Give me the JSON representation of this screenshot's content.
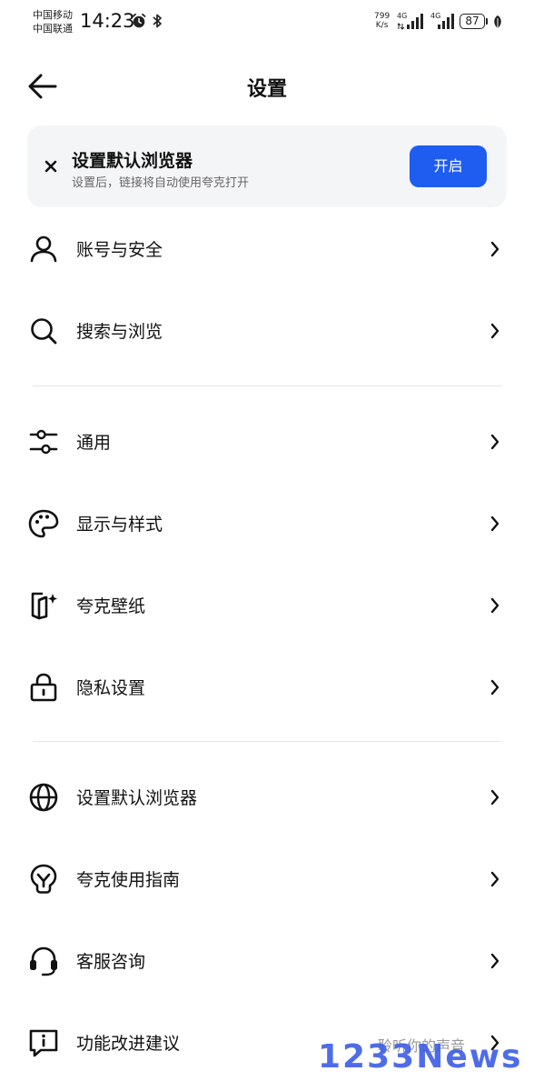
{
  "status_bar": {
    "carrier_1": "中国移动",
    "carrier_2": "中国联通",
    "time": "14:23",
    "net_speed_value": "799",
    "net_speed_unit": "K/s",
    "signal_1_label": "4G",
    "signal_2_label": "4G",
    "battery": "87"
  },
  "header": {
    "title": "设置"
  },
  "banner": {
    "title": "设置默认浏览器",
    "subtitle": "设置后，链接将自动使用夸克打开",
    "button_label": "开启"
  },
  "menu": [
    {
      "label": "账号与安全",
      "icon": "user-icon"
    },
    {
      "label": "搜索与浏览",
      "icon": "search-icon"
    },
    {
      "label": "通用",
      "icon": "sliders-icon"
    },
    {
      "label": "显示与样式",
      "icon": "palette-icon"
    },
    {
      "label": "夸克壁纸",
      "icon": "wallpaper-icon"
    },
    {
      "label": "隐私设置",
      "icon": "lock-icon"
    },
    {
      "label": "设置默认浏览器",
      "icon": "globe-icon"
    },
    {
      "label": "夸克使用指南",
      "icon": "lightbulb-icon"
    },
    {
      "label": "客服咨询",
      "icon": "headset-icon"
    },
    {
      "label": "功能改进建议",
      "icon": "feedback-icon",
      "trailing": "聆听你的声音"
    }
  ],
  "watermark": "1233News"
}
